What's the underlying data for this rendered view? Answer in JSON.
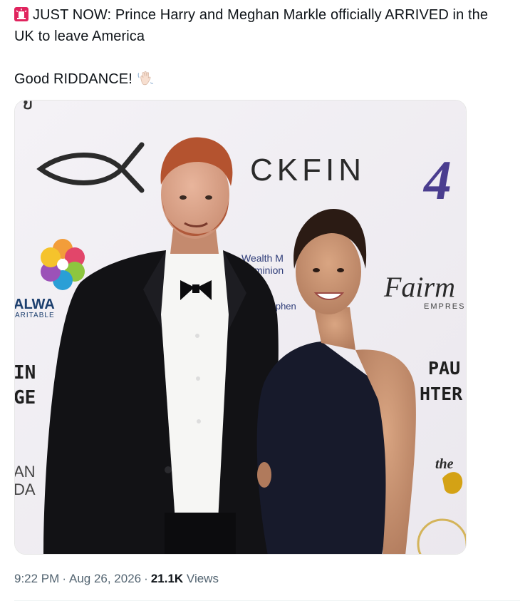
{
  "tweet": {
    "line1": "JUST NOW: Prince Harry and Meghan Markle officially ARRIVED in the",
    "line2": "UK to leave America",
    "line3": "Good RIDDANCE!",
    "emoji_start": "rotating-light-icon",
    "emoji_end": "waving-hand-icon"
  },
  "media": {
    "backdrop_texts": {
      "brand_top": "CKFIN",
      "brand_4": "4",
      "wealth_1": "Wealth M",
      "wealth_2": "Dominion",
      "stephen": "tephen",
      "fairm": "Fairm",
      "empress": "EMPRESS",
      "alwa": "ALWA",
      "aritable": "ARITABLE",
      "in": "IN",
      "ge": "GE",
      "an": "AN",
      "da": "DA",
      "paul": "PAU",
      "hter": "HTER",
      "the": "the"
    }
  },
  "meta": {
    "time": "9:22 PM",
    "date": "Aug 26, 2026",
    "views_count": "21.1K",
    "views_label": "Views"
  },
  "colors": {
    "text_primary": "#0f1419",
    "text_secondary": "#536471",
    "backdrop": "#f3f1f4",
    "suit": "#111114",
    "dress": "#16192a"
  }
}
